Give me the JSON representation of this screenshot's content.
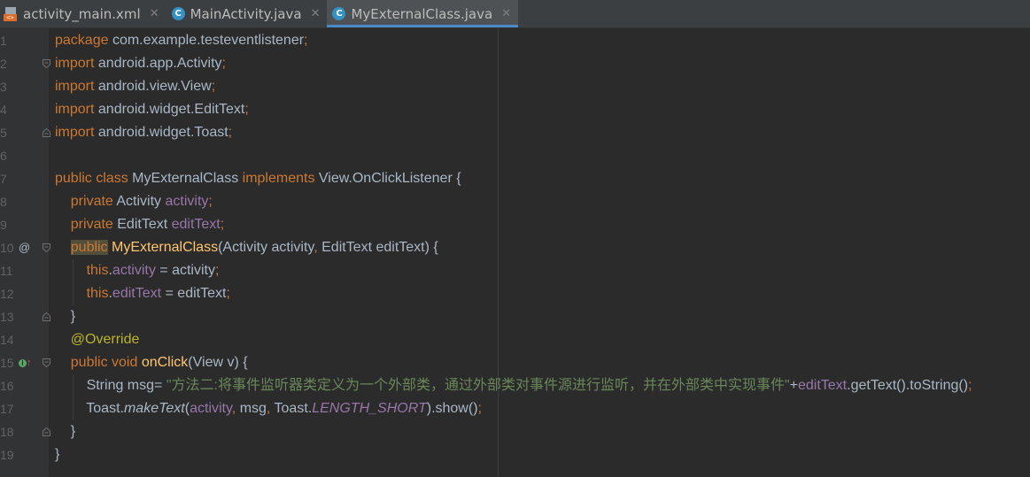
{
  "tabs": [
    {
      "label": "activity_main.xml",
      "icon": "xml-file-icon",
      "active": false
    },
    {
      "label": "MainActivity.java",
      "icon": "java-class-icon",
      "active": false
    },
    {
      "label": "MyExternalClass.java",
      "icon": "java-class-icon",
      "active": true
    }
  ],
  "tab_close_glyph": "✕",
  "gutter_markers": {
    "override": "@",
    "implements": "I"
  },
  "lines": [
    {
      "number": "1",
      "tokens": [
        {
          "text": "package",
          "style": "kw"
        },
        {
          "text": " com.example.testeventlistener",
          "style": "pl"
        },
        {
          "text": ";",
          "style": "kw"
        }
      ]
    },
    {
      "number": "2",
      "tokens": [
        {
          "text": "import",
          "style": "kw"
        },
        {
          "text": " android.app.Activity",
          "style": "pl"
        },
        {
          "text": ";",
          "style": "kw"
        }
      ]
    },
    {
      "number": "3",
      "tokens": [
        {
          "text": "import",
          "style": "kw"
        },
        {
          "text": " android.view.View",
          "style": "pl"
        },
        {
          "text": ";",
          "style": "kw"
        }
      ]
    },
    {
      "number": "4",
      "tokens": [
        {
          "text": "import",
          "style": "kw"
        },
        {
          "text": " android.widget.EditText",
          "style": "pl"
        },
        {
          "text": ";",
          "style": "kw"
        }
      ]
    },
    {
      "number": "5",
      "tokens": [
        {
          "text": "import",
          "style": "kw"
        },
        {
          "text": " android.widget.Toast",
          "style": "pl"
        },
        {
          "text": ";",
          "style": "kw"
        }
      ]
    },
    {
      "number": "6",
      "tokens": []
    },
    {
      "number": "7",
      "tokens": [
        {
          "text": "public class ",
          "style": "kw"
        },
        {
          "text": "MyExternalClass ",
          "style": "pl"
        },
        {
          "text": "implements ",
          "style": "kw"
        },
        {
          "text": "View.OnClickListener {",
          "style": "pl"
        }
      ]
    },
    {
      "number": "8",
      "tokens": [
        {
          "text": "    private ",
          "style": "kw"
        },
        {
          "text": "Activity ",
          "style": "pl"
        },
        {
          "text": "activity",
          "style": "fld"
        },
        {
          "text": ";",
          "style": "kw"
        }
      ]
    },
    {
      "number": "9",
      "tokens": [
        {
          "text": "    private ",
          "style": "kw"
        },
        {
          "text": "EditText ",
          "style": "pl"
        },
        {
          "text": "editText",
          "style": "fld"
        },
        {
          "text": ";",
          "style": "kw"
        }
      ]
    },
    {
      "number": "10",
      "tokens": [
        {
          "text": "    ",
          "style": "pl"
        },
        {
          "text": "public",
          "style": "kw hl"
        },
        {
          "text": " ",
          "style": "pl"
        },
        {
          "text": "MyExternalClass",
          "style": "fn"
        },
        {
          "text": "(Activity activity",
          "style": "pl"
        },
        {
          "text": ", ",
          "style": "kw"
        },
        {
          "text": "EditText editText) {",
          "style": "pl"
        }
      ]
    },
    {
      "number": "11",
      "tokens": [
        {
          "text": "        this",
          "style": "kw"
        },
        {
          "text": ".",
          "style": "pl"
        },
        {
          "text": "activity",
          "style": "fld"
        },
        {
          "text": " = activity",
          "style": "pl"
        },
        {
          "text": ";",
          "style": "kw"
        }
      ]
    },
    {
      "number": "12",
      "tokens": [
        {
          "text": "        this",
          "style": "kw"
        },
        {
          "text": ".",
          "style": "pl"
        },
        {
          "text": "editText",
          "style": "fld"
        },
        {
          "text": " = editText",
          "style": "pl"
        },
        {
          "text": ";",
          "style": "kw"
        }
      ]
    },
    {
      "number": "13",
      "tokens": [
        {
          "text": "    }",
          "style": "pl"
        }
      ]
    },
    {
      "number": "14",
      "tokens": [
        {
          "text": "    ",
          "style": "pl"
        },
        {
          "text": "@Override",
          "style": "ann"
        }
      ]
    },
    {
      "number": "15",
      "tokens": [
        {
          "text": "    public void ",
          "style": "kw"
        },
        {
          "text": "onClick",
          "style": "fn"
        },
        {
          "text": "(View v) {",
          "style": "pl"
        }
      ]
    },
    {
      "number": "16",
      "tokens": [
        {
          "text": "        String msg= ",
          "style": "pl"
        },
        {
          "text": "\"方法二:将事件监听器类定义为一个外部类，通过外部类对事件源进行监听，并在外部类中实现事件\"",
          "style": "str"
        },
        {
          "text": "+",
          "style": "pl"
        },
        {
          "text": "editText",
          "style": "fld"
        },
        {
          "text": ".getText().toString()",
          "style": "pl"
        },
        {
          "text": ";",
          "style": "kw"
        }
      ]
    },
    {
      "number": "17",
      "tokens": [
        {
          "text": "        Toast.",
          "style": "pl"
        },
        {
          "text": "makeText",
          "style": "pl sta"
        },
        {
          "text": "(",
          "style": "pl"
        },
        {
          "text": "activity",
          "style": "fld"
        },
        {
          "text": ", ",
          "style": "kw"
        },
        {
          "text": "msg",
          "style": "pl"
        },
        {
          "text": ", ",
          "style": "kw"
        },
        {
          "text": "Toast.",
          "style": "pl"
        },
        {
          "text": "LENGTH_SHORT",
          "style": "stafld"
        },
        {
          "text": ").show()",
          "style": "pl"
        },
        {
          "text": ";",
          "style": "kw"
        }
      ]
    },
    {
      "number": "18",
      "tokens": [
        {
          "text": "    }",
          "style": "pl"
        }
      ]
    },
    {
      "number": "19",
      "tokens": [
        {
          "text": "}",
          "style": "pl"
        }
      ]
    }
  ]
}
